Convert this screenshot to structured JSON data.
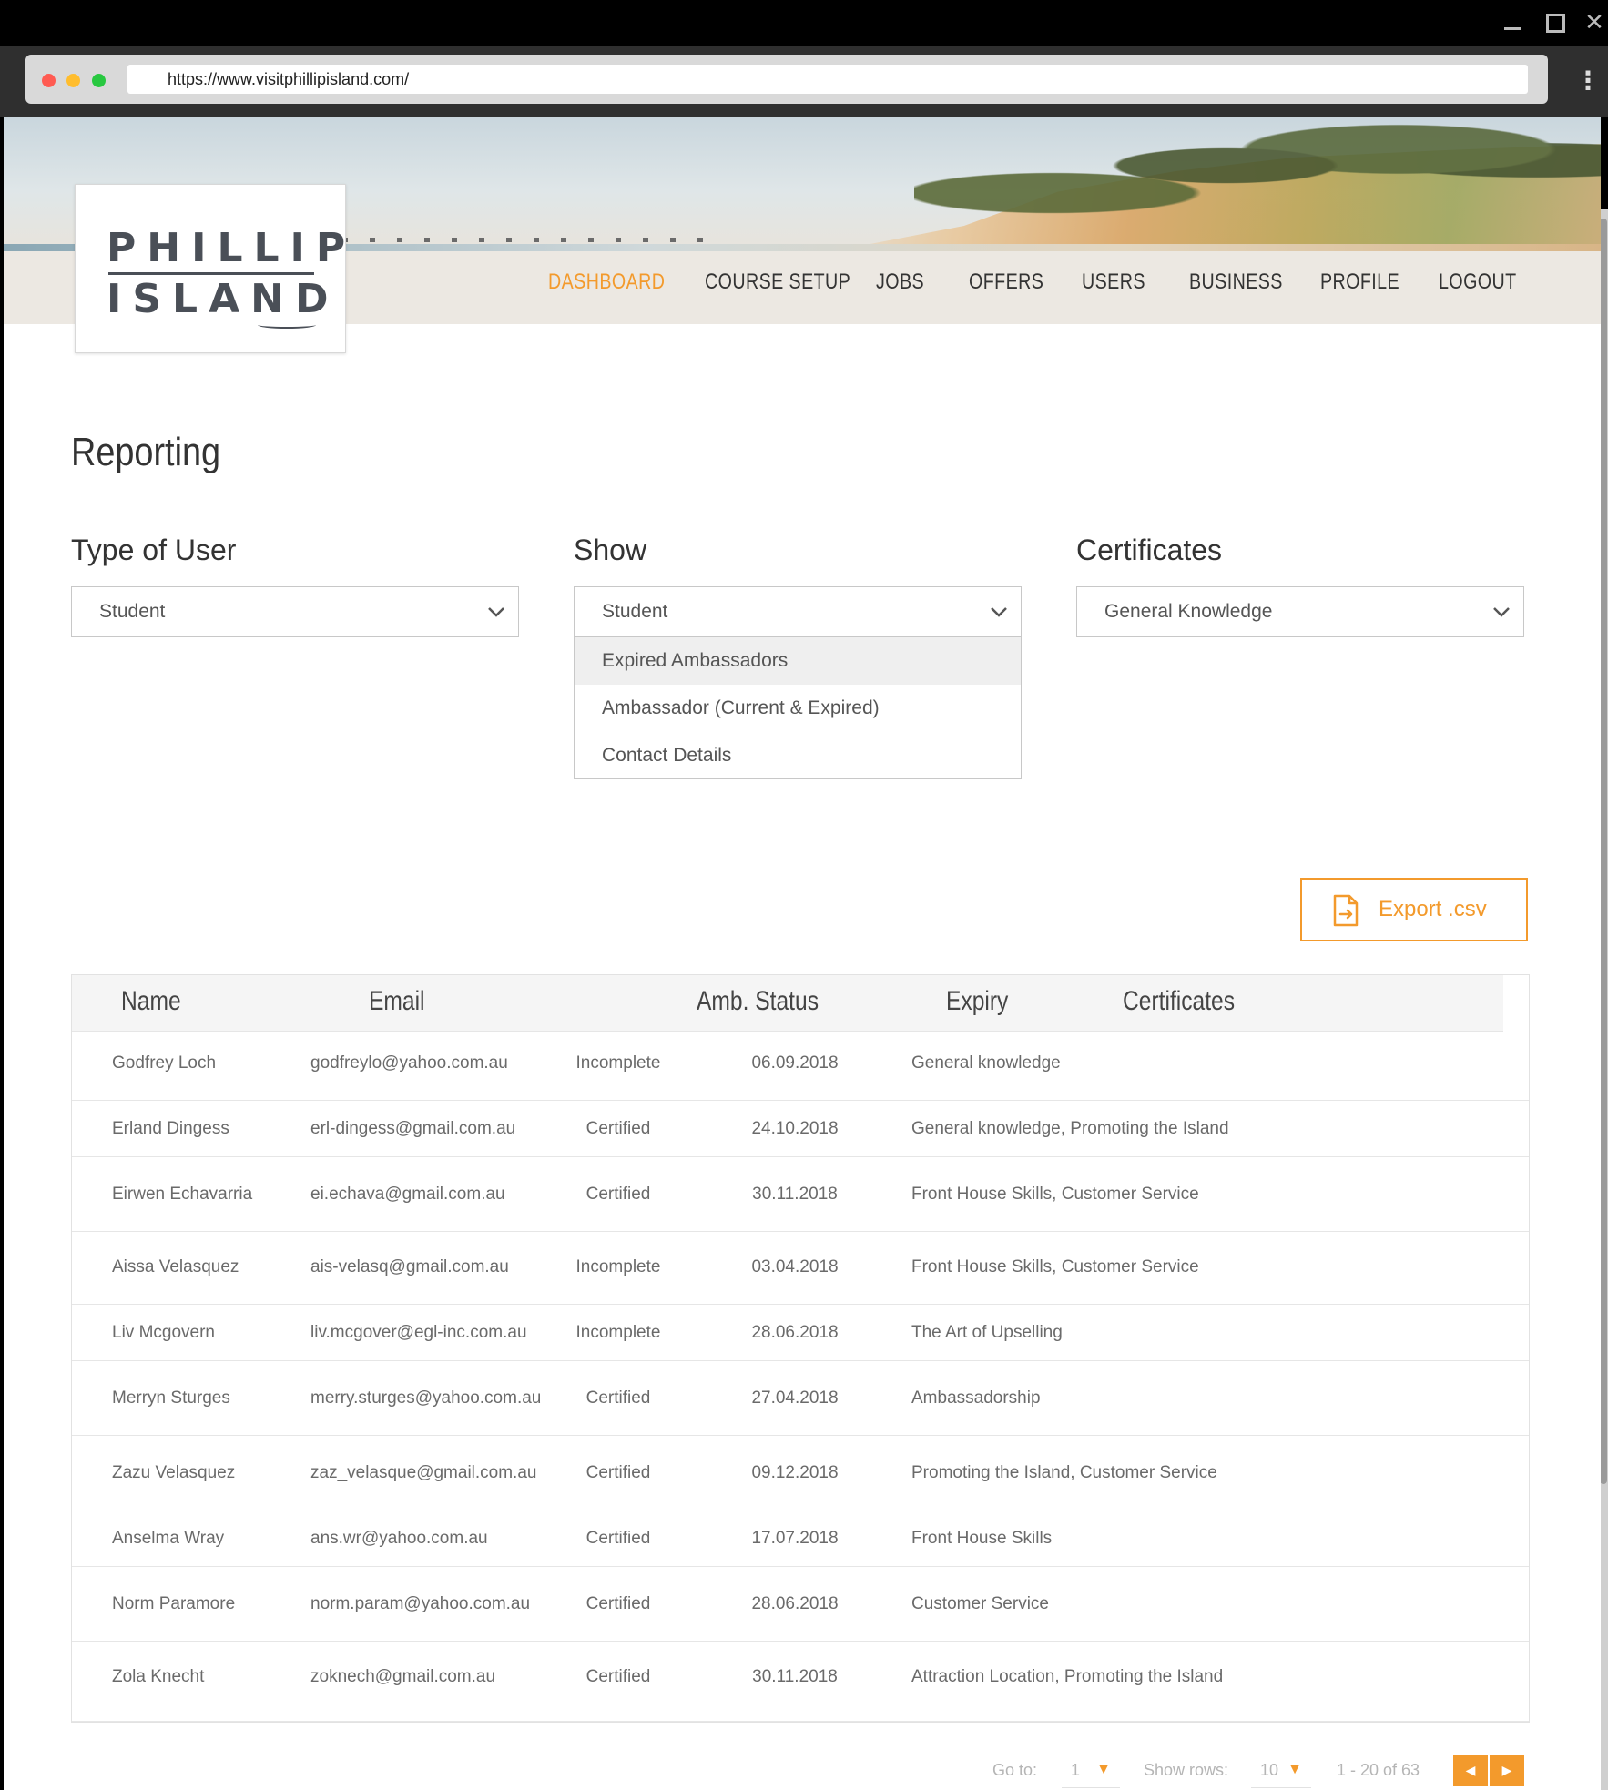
{
  "browser": {
    "url": "https://www.visitphillipisland.com/"
  },
  "logo": {
    "line1": "PHILLIP",
    "line2": "ISLAND"
  },
  "nav": [
    {
      "label": "DASHBOARD",
      "active": true
    },
    {
      "label": "COURSE SETUP",
      "active": false
    },
    {
      "label": "JOBS",
      "active": false
    },
    {
      "label": "OFFERS",
      "active": false
    },
    {
      "label": "USERS",
      "active": false
    },
    {
      "label": "BUSINESS",
      "active": false
    },
    {
      "label": "PROFILE",
      "active": false
    },
    {
      "label": "LOGOUT",
      "active": false
    }
  ],
  "page": {
    "title": "Reporting"
  },
  "filters": {
    "type_of_user": {
      "label": "Type of User",
      "value": "Student"
    },
    "show": {
      "label": "Show",
      "value": "Student",
      "options": [
        "Expired Ambassadors",
        "Ambassador (Current & Expired)",
        "Contact Details"
      ],
      "highlighted_option": "Expired Ambassadors"
    },
    "certificates": {
      "label": "Certificates",
      "value": "General Knowledge"
    }
  },
  "export": {
    "label": "Export .csv"
  },
  "table": {
    "columns": [
      "Name",
      "Email",
      "Amb. Status",
      "Expiry",
      "Certificates"
    ],
    "rows": [
      {
        "name": "Godfrey Loch",
        "email": "godfreylo@yahoo.com.au",
        "status": "Incomplete",
        "expiry": "06.09.2018",
        "certificates": "General knowledge"
      },
      {
        "name": "Erland Dingess",
        "email": "erl-dingess@gmail.com.au",
        "status": "Certified",
        "expiry": "24.10.2018",
        "certificates": "General knowledge, Promoting the Island"
      },
      {
        "name": "Eirwen Echavarria",
        "email": "ei.echava@gmail.com.au",
        "status": "Certified",
        "expiry": "30.11.2018",
        "certificates": "Front House Skills, Customer Service"
      },
      {
        "name": "Aissa Velasquez",
        "email": "ais-velasq@gmail.com.au",
        "status": "Incomplete",
        "expiry": "03.04.2018",
        "certificates": "Front House Skills, Customer Service"
      },
      {
        "name": "Liv Mcgovern",
        "email": "liv.mcgover@egl-inc.com.au",
        "status": "Incomplete",
        "expiry": "28.06.2018",
        "certificates": "The Art of Upselling"
      },
      {
        "name": "Merryn Sturges",
        "email": "merry.sturges@yahoo.com.au",
        "status": "Certified",
        "expiry": "27.04.2018",
        "certificates": "Ambassadorship"
      },
      {
        "name": "Zazu Velasquez",
        "email": "zaz_velasque@gmail.com.au",
        "status": "Certified",
        "expiry": "09.12.2018",
        "certificates": "Promoting the Island, Customer Service"
      },
      {
        "name": "Anselma Wray",
        "email": "ans.wr@yahoo.com.au",
        "status": "Certified",
        "expiry": "17.07.2018",
        "certificates": "Front House Skills"
      },
      {
        "name": "Norm Paramore",
        "email": "norm.param@yahoo.com.au",
        "status": "Certified",
        "expiry": "28.06.2018",
        "certificates": "Customer Service"
      },
      {
        "name": "Zola Knecht",
        "email": "zoknech@gmail.com.au",
        "status": "Certified",
        "expiry": "30.11.2018",
        "certificates": "Attraction Location, Promoting the Island"
      }
    ]
  },
  "pagination": {
    "goto_label": "Go to:",
    "goto_value": "1",
    "rows_label": "Show rows:",
    "rows_value": "10",
    "range": "1 - 20 of 63"
  },
  "colors": {
    "accent": "#f39a2c",
    "text": "#555555",
    "border": "#c8c8c8"
  },
  "icons": {
    "window": [
      "minimize-icon",
      "maximize-icon",
      "close-icon"
    ],
    "select": "chevron-down-icon",
    "export": "file-export-icon",
    "pager": [
      "arrow-left-icon",
      "arrow-right-icon"
    ]
  }
}
